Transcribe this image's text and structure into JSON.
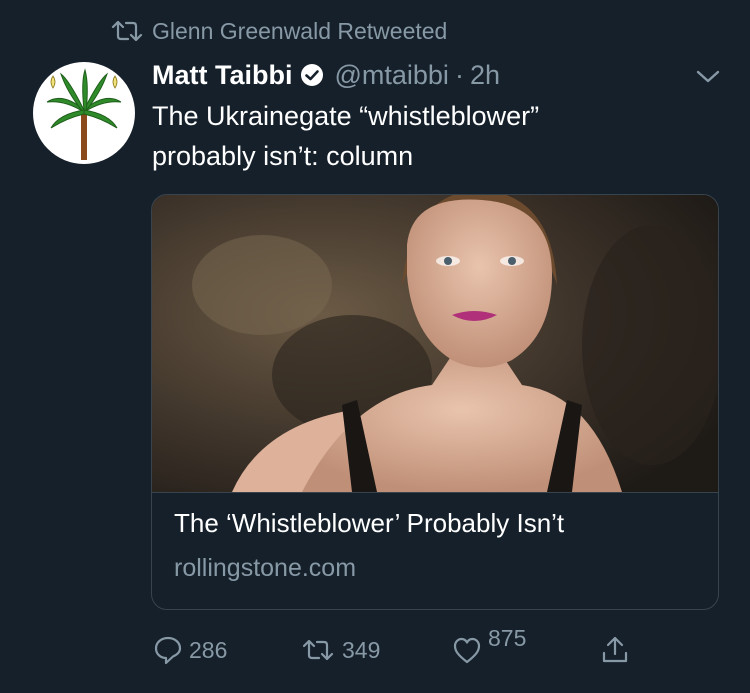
{
  "retweet": {
    "label": "Glenn Greenwald Retweeted",
    "icon": "retweet-icon"
  },
  "tweet": {
    "author_name": "Matt Taibbi",
    "handle": "@mtaibbi",
    "separator": "·",
    "time": "2h",
    "text_line1": "The Ukrainegate “whistleblower”",
    "text_line2": "probably isn’t: column"
  },
  "card": {
    "title": "The ‘Whistleblower’ Probably Isn’t",
    "domain": "rollingstone.com"
  },
  "actions": {
    "replies": "286",
    "retweets": "349",
    "likes": "875"
  },
  "colors": {
    "background": "#15202b",
    "secondary_text": "#8899a6",
    "verified_blue": "#ffffff",
    "lipstick": "#b0307a"
  }
}
